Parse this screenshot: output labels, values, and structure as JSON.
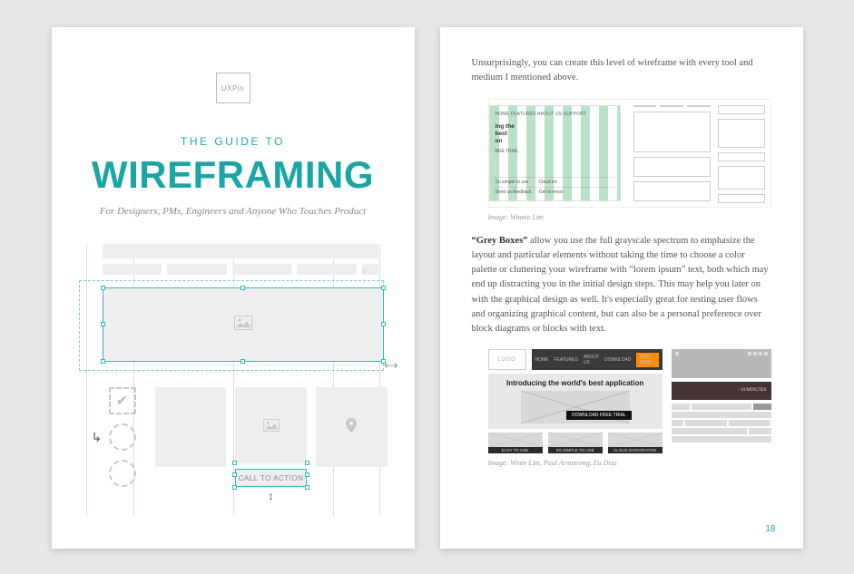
{
  "left": {
    "brand": "UXPin",
    "kicker": "THE GUIDE TO",
    "title": "WIREFRAMING",
    "subtitle": "For Designers, PMs, Engineers and Anyone Who Touches Product",
    "cta_label": "CALL TO ACTION"
  },
  "right": {
    "intro": "Unsurprisingly, you can create this level of wireframe with every tool and medium I mentioned above.",
    "fig1": {
      "nav": "HOME    FEATURES    ABOUT US    SUPPORT",
      "hero_l1": "ing the",
      "hero_l2": "best",
      "hero_l3": "on",
      "trial": "REE TRIAL",
      "simple": "So simple to use",
      "cloud": "Cloud int",
      "feedback": "Send us feedback",
      "know": "Get to know",
      "caption": "Image: Winnie Lim"
    },
    "grey_boxes_label": "“Grey Boxes”",
    "grey_boxes_text": " allow you use the full grayscale spectrum to emphasize the layout and particular elements without taking the time to choose a color palette or cluttering your wireframe with “lorem ipsum” text, both which may end up distracting you in the initial design steps. This may help you later on with the graphical design as well. It's especially great for testing user flows and organizing graphical content, but can also be a personal preference over block diagrams or blocks with text.",
    "fig2": {
      "logo": "LOGO",
      "nav_home": "HOME",
      "nav_features": "FEATURES",
      "nav_about": "ABOUT US",
      "nav_download": "DOWNLOAD",
      "buy": "BUY NOW",
      "hero_title": "Introducing the world's best application",
      "cta": "DOWNLOAD FREE TRIAL",
      "thumb1": "EASY TO USE",
      "thumb2": "SO SIMPLE TO USE",
      "thumb3": "CLOUD INTEGRATION",
      "right_hero": "/ 10 MINUTES",
      "caption": "Image: Winie Lim, Paul Armstrong, Eu Diaz"
    },
    "page_number": "18"
  }
}
